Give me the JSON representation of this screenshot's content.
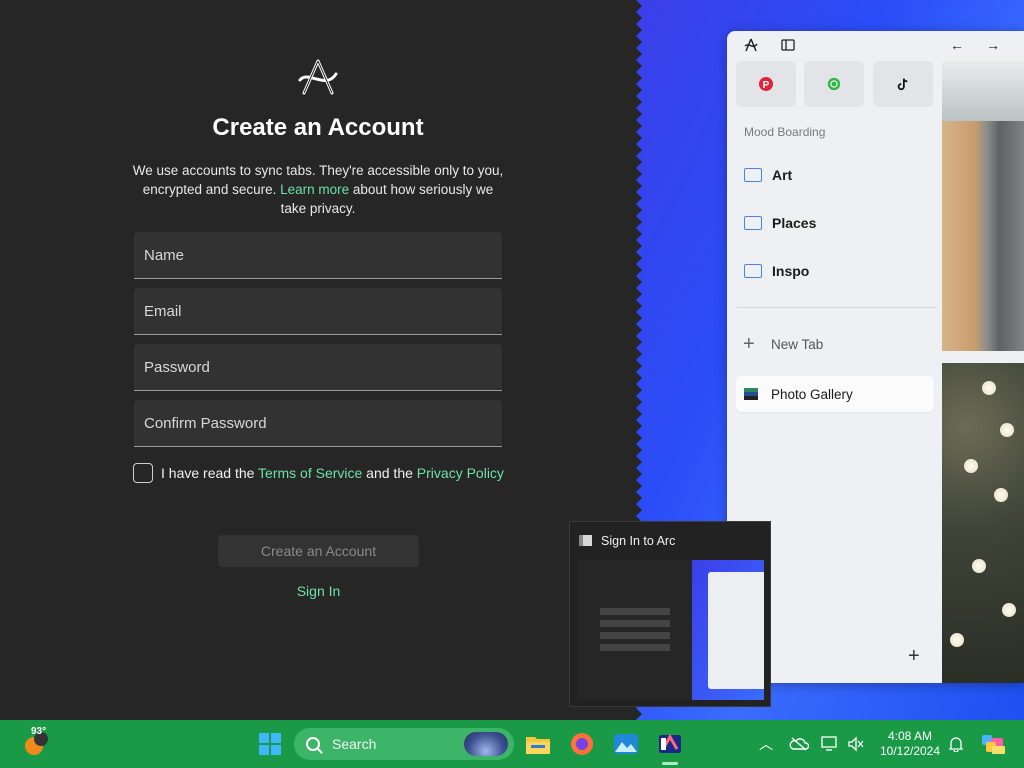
{
  "signup": {
    "title": "Create an Account",
    "desc_part1": "We use accounts to sync tabs. They're accessible only to you, encrypted and secure. ",
    "desc_link": "Learn more",
    "desc_part2": " about how seriously we take privacy.",
    "fields": {
      "name_placeholder": "Name",
      "email_placeholder": "Email",
      "password_placeholder": "Password",
      "confirm_placeholder": "Confirm Password"
    },
    "agree_part1": "I have read the ",
    "terms_link": "Terms of Service",
    "agree_part2": " and the ",
    "privacy_link": "Privacy Policy",
    "create_button": "Create an Account",
    "signin_link": "Sign In"
  },
  "arc": {
    "section_label": "Mood Boarding",
    "folders": [
      "Art",
      "Places",
      "Inspo"
    ],
    "new_tab": "New Tab",
    "gallery_tab": "Photo Gallery",
    "pins": [
      "pinterest-icon",
      "whatsapp-icon",
      "tiktok-icon"
    ]
  },
  "preview": {
    "title": "Sign In to Arc"
  },
  "taskbar": {
    "weather_temp": "93°",
    "search_label": "Search",
    "time": "4:08 AM",
    "date": "10/12/2024"
  },
  "colors": {
    "link_green": "#6fe0a8",
    "taskbar_green": "#1a9a47",
    "panel_dark": "#262626",
    "accent_blue": "#2a4df7"
  }
}
